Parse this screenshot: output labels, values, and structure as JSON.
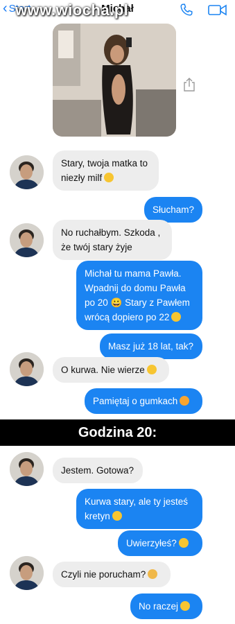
{
  "header": {
    "back_label": "Start",
    "contact_name": "Michał",
    "watermark": "www.wiocha.pl"
  },
  "divider_label": "Godzina 20:",
  "messages": [
    {
      "side": "in",
      "text": "Stary, twoja matka to niezły milf",
      "emoji": "smile"
    },
    {
      "side": "out",
      "text": "Słucham?",
      "emoji": ""
    },
    {
      "side": "in",
      "text": "No ruchałbym. Szkoda , że twój stary żyje",
      "emoji": ""
    },
    {
      "side": "out",
      "text": "Michał tu mama Pawła. Wpadnij do domu Pawła po 20 😀 Stary z Pawłem wrócą dopiero po 22",
      "emoji": "wink"
    },
    {
      "side": "out",
      "text": "Masz już 18 lat, tak?",
      "emoji": ""
    },
    {
      "side": "in",
      "text": "O kurwa. Nie wierze",
      "emoji": "smile"
    },
    {
      "side": "out",
      "text": "Pamiętaj o gumkach",
      "emoji": "kiss"
    },
    {
      "side": "in",
      "text": "Jestem. Gotowa?",
      "emoji": ""
    },
    {
      "side": "out",
      "text": "Kurwa stary, ale ty jesteś kretyn",
      "emoji": "smile"
    },
    {
      "side": "out",
      "text": "Uwierzyłeś?",
      "emoji": "smile"
    },
    {
      "side": "in",
      "text": "Czyli nie porucham?",
      "emoji": "sad"
    },
    {
      "side": "out",
      "text": "No raczej",
      "emoji": "smile"
    }
  ],
  "colors": {
    "accent": "#1b84f2",
    "incoming_bubble": "#ededed",
    "divider_bg": "#000000"
  },
  "icons": {
    "back": "chevron-left-icon",
    "call": "phone-icon",
    "video": "video-camera-icon",
    "share": "share-icon"
  }
}
